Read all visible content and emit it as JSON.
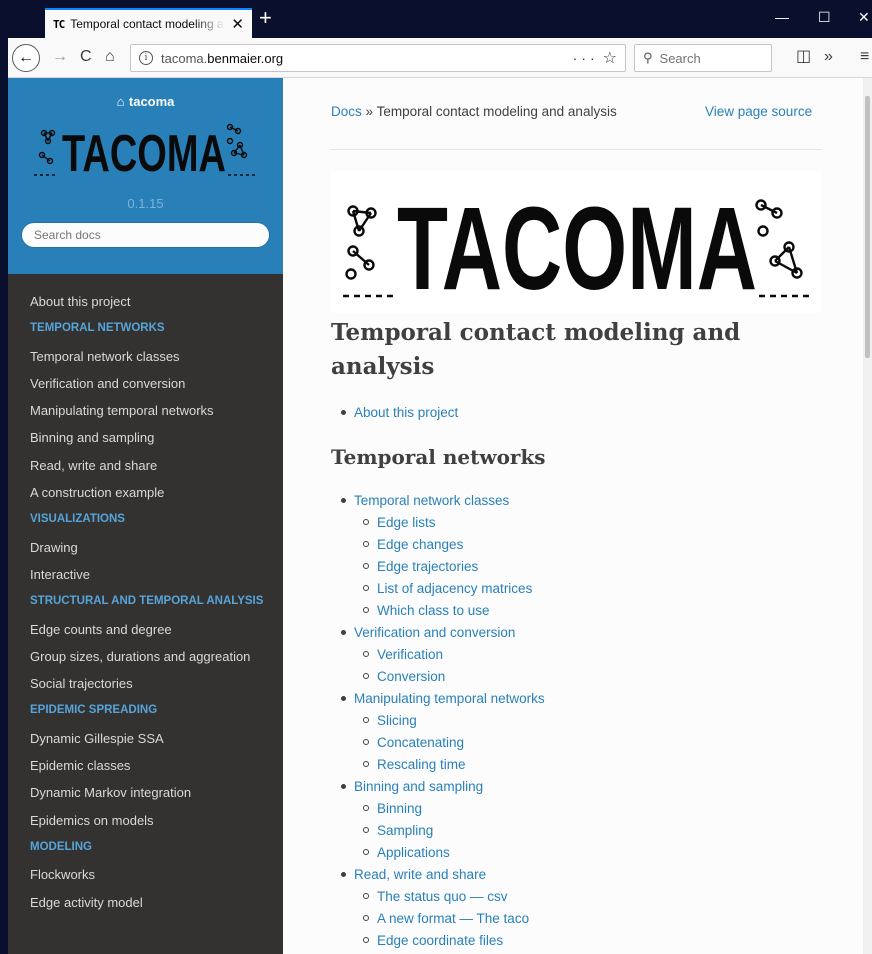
{
  "browser": {
    "tab_favicon": "TC",
    "tab_title": "Temporal contact modeling and analysis",
    "url_prefix": "tacoma.",
    "url_domain": "benmaier.org",
    "search_placeholder": "Search",
    "url_more": "···",
    "new_tab": "+",
    "close_tab": "✕"
  },
  "sidebar": {
    "home_label": "tacoma",
    "logo_text": "TACOMA",
    "version": "0.1.15",
    "search_placeholder": "Search docs",
    "menu": [
      {
        "kind": "item",
        "label": "About this project"
      },
      {
        "kind": "caption",
        "label": "TEMPORAL NETWORKS"
      },
      {
        "kind": "item",
        "label": "Temporal network classes"
      },
      {
        "kind": "item",
        "label": "Verification and conversion"
      },
      {
        "kind": "item",
        "label": "Manipulating temporal networks"
      },
      {
        "kind": "item",
        "label": "Binning and sampling"
      },
      {
        "kind": "item",
        "label": "Read, write and share"
      },
      {
        "kind": "item",
        "label": "A construction example"
      },
      {
        "kind": "caption",
        "label": "VISUALIZATIONS"
      },
      {
        "kind": "item",
        "label": "Drawing"
      },
      {
        "kind": "item",
        "label": "Interactive"
      },
      {
        "kind": "caption",
        "label": "STRUCTURAL AND TEMPORAL ANALYSIS"
      },
      {
        "kind": "item",
        "label": "Edge counts and degree"
      },
      {
        "kind": "item",
        "label": "Group sizes, durations and aggreation"
      },
      {
        "kind": "item",
        "label": "Social trajectories"
      },
      {
        "kind": "caption",
        "label": "EPIDEMIC SPREADING"
      },
      {
        "kind": "item",
        "label": "Dynamic Gillespie SSA"
      },
      {
        "kind": "item",
        "label": "Epidemic classes"
      },
      {
        "kind": "item",
        "label": "Dynamic Markov integration"
      },
      {
        "kind": "item",
        "label": "Epidemics on models"
      },
      {
        "kind": "caption",
        "label": "MODELING"
      },
      {
        "kind": "item",
        "label": "Flockworks"
      },
      {
        "kind": "item",
        "label": "Edge activity model"
      }
    ]
  },
  "content": {
    "breadcrumb_docs": "Docs",
    "breadcrumb_sep": "»",
    "breadcrumb_current": "Temporal contact modeling and analysis",
    "view_source": "View page source",
    "logo_text": "TACOMA",
    "title": "Temporal contact modeling and analysis",
    "intro_link": "About this project",
    "section_title": "Temporal networks",
    "toc": [
      {
        "level": 1,
        "label": "Temporal network classes"
      },
      {
        "level": 2,
        "label": "Edge lists"
      },
      {
        "level": 2,
        "label": "Edge changes"
      },
      {
        "level": 2,
        "label": "Edge trajectories"
      },
      {
        "level": 2,
        "label": "List of adjacency matrices"
      },
      {
        "level": 2,
        "label": "Which class to use"
      },
      {
        "level": 1,
        "label": "Verification and conversion"
      },
      {
        "level": 2,
        "label": "Verification"
      },
      {
        "level": 2,
        "label": "Conversion"
      },
      {
        "level": 1,
        "label": "Manipulating temporal networks"
      },
      {
        "level": 2,
        "label": "Slicing"
      },
      {
        "level": 2,
        "label": "Concatenating"
      },
      {
        "level": 2,
        "label": "Rescaling time"
      },
      {
        "level": 1,
        "label": "Binning and sampling"
      },
      {
        "level": 2,
        "label": "Binning"
      },
      {
        "level": 2,
        "label": "Sampling"
      },
      {
        "level": 2,
        "label": "Applications"
      },
      {
        "level": 1,
        "label": "Read, write and share"
      },
      {
        "level": 2,
        "label": "The status quo — csv"
      },
      {
        "level": 2,
        "label": "A new format — The taco"
      },
      {
        "level": 2,
        "label": "Edge coordinate files"
      }
    ]
  },
  "colors": {
    "sidebar_bg": "#343131",
    "sidebar_header": "#2980b9",
    "link": "#2980b9",
    "caption": "#55a5d9",
    "chrome_dark": "#0a0f2d"
  }
}
